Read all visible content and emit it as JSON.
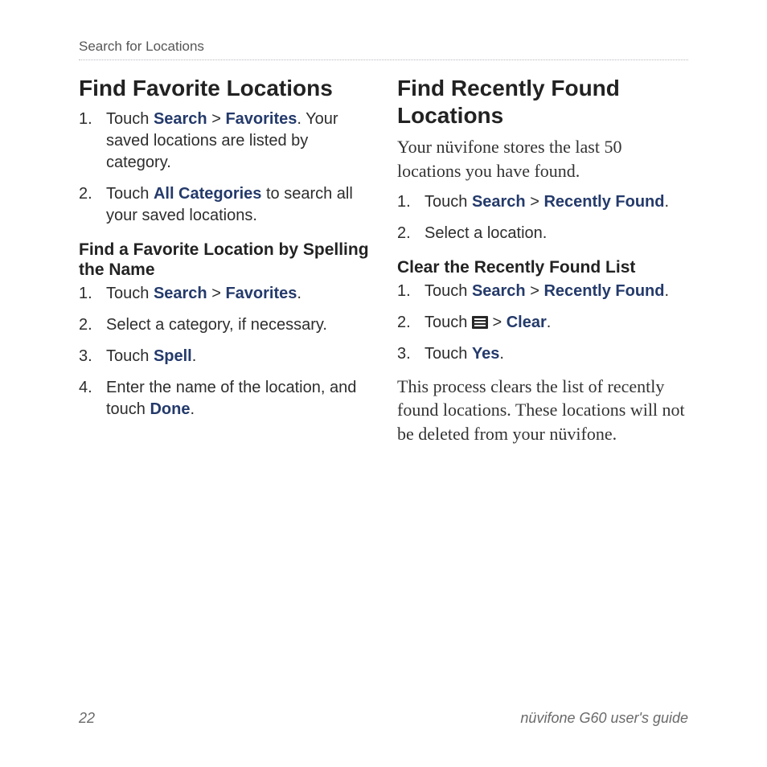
{
  "header": {
    "breadcrumb": "Search for Locations"
  },
  "left": {
    "title": "Find Favorite Locations",
    "steps": [
      {
        "pre": "Touch ",
        "kw1": "Search",
        "mid": " > ",
        "kw2": "Favorites",
        "post": ". Your saved locations are listed by category."
      },
      {
        "pre": "Touch ",
        "kw1": "All Categories",
        "post": " to search all your saved locations."
      }
    ],
    "sub": {
      "title": "Find a Favorite Location by Spelling the Name",
      "steps": [
        {
          "pre": "Touch ",
          "kw1": "Search",
          "mid": " > ",
          "kw2": "Favorites",
          "post": "."
        },
        {
          "pre": "Select a category, if necessary."
        },
        {
          "pre": "Touch ",
          "kw1": "Spell",
          "post": "."
        },
        {
          "pre": "Enter the name of the location, and touch ",
          "kw1": "Done",
          "post": "."
        }
      ]
    }
  },
  "right": {
    "title": "Find Recently Found Locations",
    "intro": "Your nüvifone stores the last 50 locations you have found.",
    "steps": [
      {
        "pre": "Touch ",
        "kw1": "Search",
        "mid": " > ",
        "kw2": "Recently Found",
        "post": "."
      },
      {
        "pre": "Select a location."
      }
    ],
    "sub": {
      "title": "Clear the Recently Found List",
      "steps": [
        {
          "pre": "Touch ",
          "kw1": "Search",
          "mid": " > ",
          "kw2": "Recently Found",
          "post": "."
        },
        {
          "pre": "Touch ",
          "icon": "menu",
          "mid2": " > ",
          "kw1": "Clear",
          "post": "."
        },
        {
          "pre": "Touch ",
          "kw1": "Yes",
          "post": "."
        }
      ],
      "note": "This process clears the list of recently found locations. These locations will not be deleted from your nüvifone."
    }
  },
  "footer": {
    "page": "22",
    "guide": "nüvifone G60 user's guide"
  }
}
